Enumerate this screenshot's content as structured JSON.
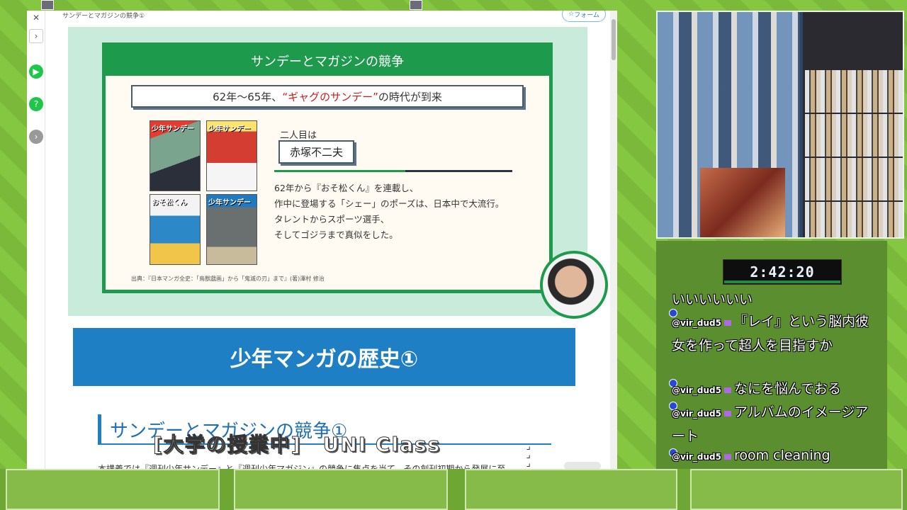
{
  "browser": {
    "tab_title": "サンデーとマガジンの競争①",
    "follow_label": "フォーム",
    "close_icon": "close-icon",
    "expand_icon": "chevron-right-icon"
  },
  "slide": {
    "heading": "サンデーとマガジンの競争",
    "ribbon_pre": "62年〜65年、",
    "ribbon_red": "“ギャグのサンデー”",
    "ribbon_post": "の時代が到来",
    "second_label": "二人目は",
    "name": "赤塚不二夫",
    "body": [
      "62年から『おそ松くん』を連載し、",
      "作中に登場する「シェー」のポーズは、日本中で大流行。",
      "タレントからスポーツ選手、",
      "そしてゴジラまで真似をした。"
    ],
    "source": "出典：『日本マンガ全史：「鳥獣戯画」から「鬼滅の刃」まで』(著)澤村 修治",
    "covers": [
      "少年サンデー",
      "少年サンデー",
      "おそ松くん",
      "少年サンデー"
    ]
  },
  "page": {
    "hero_title": "少年マンガの歴史①",
    "section_title": "サンデーとマガジンの競争①",
    "body_truncated": "本講義では『週刊少年サンデー』と『週刊少年マガジン』の競争に焦点を当て、その創刊初期から発展に至"
  },
  "overlay": {
    "caption": "[大学の授業中]　UNI Class",
    "menu_icon": "more-vertical-icon"
  },
  "timer": "2:42:20",
  "chat": [
    {
      "user": "",
      "text": "いいいいいい"
    },
    {
      "user": "@vir_dud5",
      "text": "『レイ』という脳内彼女を作って超人を目指すか"
    },
    {
      "user": "@vir_dud5",
      "text": "なにを悩んでおる"
    },
    {
      "user": "@vir_dud5",
      "text": "アルバムのイメージアート"
    },
    {
      "user": "@vir_dud5",
      "text": "room cleaning"
    }
  ]
}
